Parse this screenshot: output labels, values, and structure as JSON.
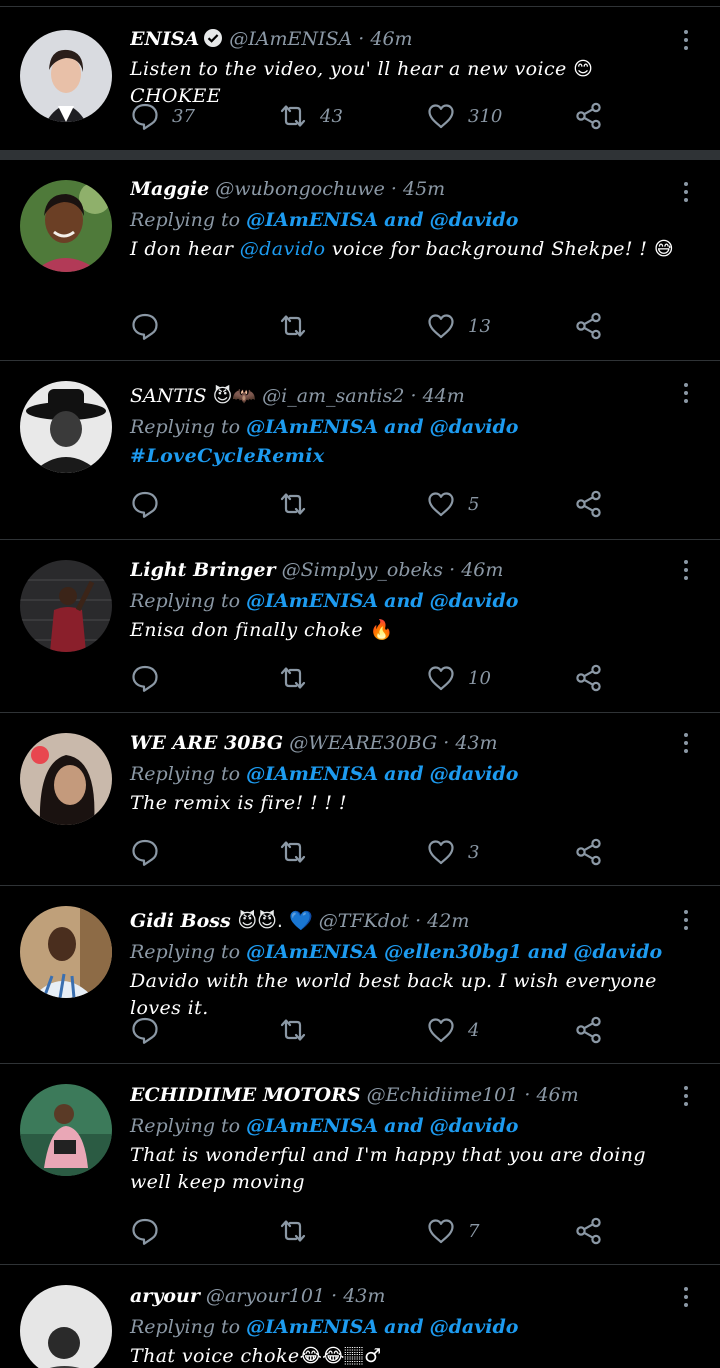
{
  "colors": {
    "background": "#000000",
    "divider": "#2f3336",
    "link": "#1d9bf0",
    "muted": "#8b98a5",
    "text": "#ffffff"
  },
  "icons": {
    "reply": "speech-bubble-icon",
    "retweet": "retweet-arrows-icon",
    "like": "heart-icon",
    "share": "share-nodes-icon",
    "more": "vertical-dots-icon",
    "verified": "verified-badge-icon"
  },
  "main_tweet": {
    "name": "ENISA",
    "handle": "@IAmENISA",
    "time": "46m",
    "text_a": "Listen to the video,  you' ll hear a new voice ",
    "emoji": "😊",
    "text_b": " CHOKEE",
    "replies": "37",
    "retweets": "43",
    "likes": "310"
  },
  "replies": [
    {
      "name": "Maggie",
      "handle": "@wubongochuwe",
      "time": "45m",
      "reply_prefix": "Replying to",
      "reply_to_a": "@IAmENISA",
      "reply_and": "and",
      "reply_to_b": "@davido",
      "text_a": "I don hear ",
      "text_mention": "@davido",
      "text_b": " voice for background Shekpe! ! ",
      "emoji": "😅",
      "replies": "",
      "retweets": "",
      "likes": "13"
    },
    {
      "name": "SANTIS ",
      "name_emoji": "😈🦇",
      "handle": "@i_am_santis2",
      "time": "44m",
      "reply_prefix": "Replying to",
      "reply_to_a": "@IAmENISA",
      "reply_and": "and",
      "reply_to_b": "@davido",
      "hashtag": "#LoveCycleRemix",
      "replies": "",
      "retweets": "",
      "likes": "5"
    },
    {
      "name": "Light Bringer",
      "handle": "@Simplyy_obeks",
      "time": "46m",
      "reply_prefix": "Replying to",
      "reply_to_a": "@IAmENISA",
      "reply_and": "and",
      "reply_to_b": "@davido",
      "text": "Enisa don finally choke ",
      "emoji": "🔥",
      "replies": "",
      "retweets": "",
      "likes": "10"
    },
    {
      "name": "WE ARE 30BG",
      "handle": "@WEARE30BG",
      "time": "43m",
      "reply_prefix": "Replying to",
      "reply_to_a": "@IAmENISA",
      "reply_and": "and",
      "reply_to_b": "@davido",
      "text": "The remix is fire! ! ! !",
      "replies": "",
      "retweets": "",
      "likes": "3"
    },
    {
      "name": "Gidi Boss ",
      "name_emoji": "😈😈.  💙",
      "handle": "@TFKdot",
      "time": "42m",
      "reply_prefix": "Replying to",
      "reply_to_a": "@IAmENISA",
      "reply_to_c": "@ellen30bg1",
      "reply_and": "and",
      "reply_to_b": "@davido",
      "text": "Davido with the world best back up.  I wish everyone loves it.",
      "replies": "",
      "retweets": "",
      "likes": "4"
    },
    {
      "name": "ECHIDIIME MOTORS",
      "handle": "@Echidiime101",
      "time": "46m",
      "reply_prefix": "Replying to",
      "reply_to_a": "@IAmENISA",
      "reply_and": "and",
      "reply_to_b": "@davido",
      "text": "That is wonderful and I'm happy that you are doing well keep moving",
      "replies": "",
      "retweets": "",
      "likes": "7"
    },
    {
      "name": "aryour",
      "handle": "@aryour101",
      "time": "43m",
      "reply_prefix": "Replying to",
      "reply_to_a": "@IAmENISA",
      "reply_and": "and",
      "reply_to_b": "@davido",
      "text": "That voice choke",
      "emoji": "😂😂🏽♂"
    }
  ]
}
